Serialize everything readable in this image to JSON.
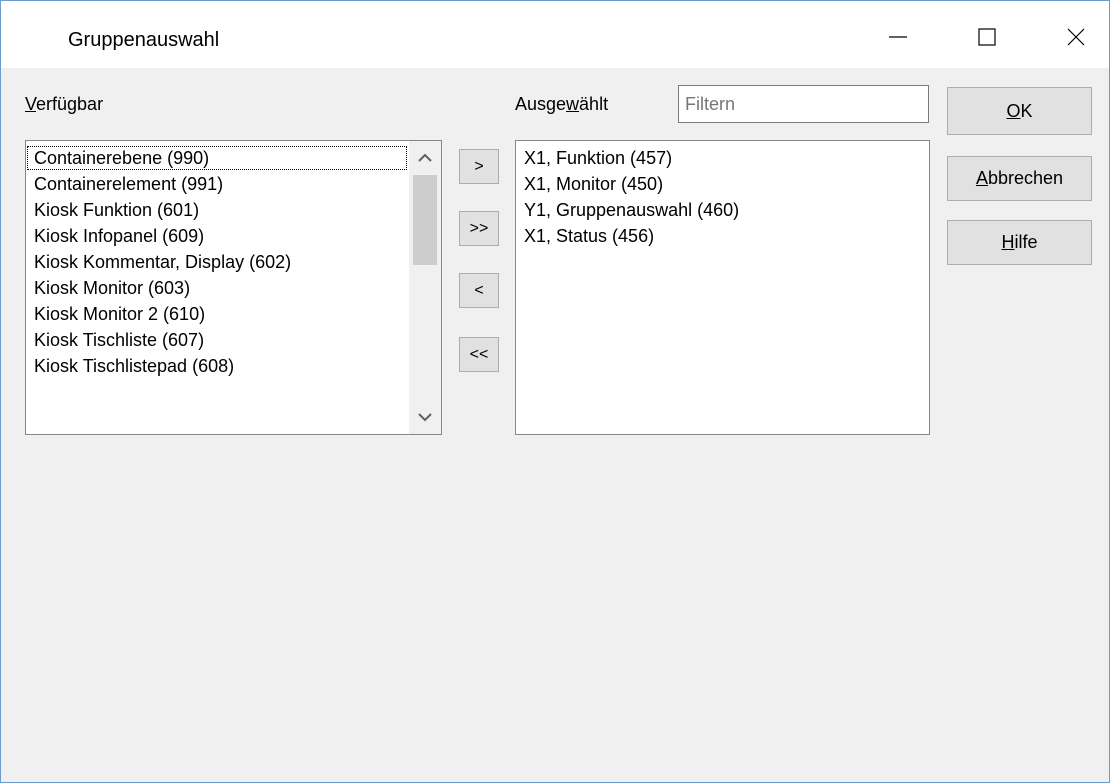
{
  "window": {
    "title": "Gruppenauswahl",
    "controls": {
      "minimize": "minimize-icon",
      "maximize": "maximize-icon",
      "close": "close-icon"
    }
  },
  "available": {
    "label_mnemonic": "V",
    "label_rest": "erfügbar",
    "items": [
      "Containerebene (990)",
      "Containerelement (991)",
      "Kiosk Funktion (601)",
      "Kiosk Infopanel (609)",
      "Kiosk Kommentar, Display (602)",
      "Kiosk Monitor (603)",
      "Kiosk Monitor 2 (610)",
      "Kiosk Tischliste (607)",
      "Kiosk Tischlistepad (608)"
    ]
  },
  "selected": {
    "label_pre": "Ausge",
    "label_mnemonic": "w",
    "label_post": "ählt",
    "filter_placeholder": "Filtern",
    "items": [
      "X1, Funktion (457)",
      "X1, Monitor (450)",
      "Y1, Gruppenauswahl (460)",
      "X1, Status (456)"
    ]
  },
  "transfer_buttons": {
    "add": ">",
    "add_all": ">>",
    "remove": "<",
    "remove_all": "<<"
  },
  "buttons": {
    "ok_mnemonic": "O",
    "ok_rest": "K",
    "cancel_mnemonic": "A",
    "cancel_rest": "bbrechen",
    "help_mnemonic": "H",
    "help_rest": "ilfe"
  }
}
